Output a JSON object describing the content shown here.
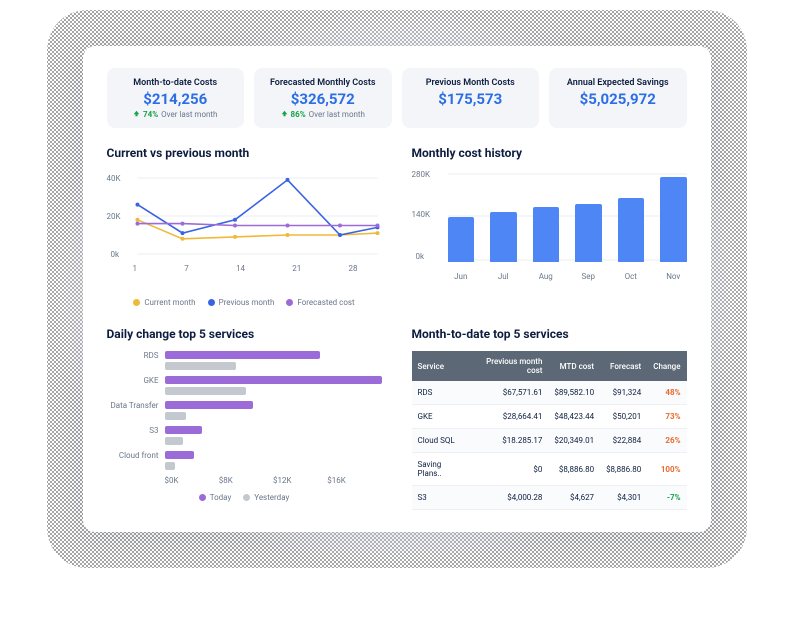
{
  "kpis": [
    {
      "title": "Month-to-date Costs",
      "value": "$214,256",
      "pct": "74%",
      "sub": "Over last month",
      "arrow": true
    },
    {
      "title": "Forecasted Monthly Costs",
      "value": "$326,572",
      "pct": "86%",
      "sub": "Over last month",
      "arrow": true
    },
    {
      "title": "Previous Month Costs",
      "value": "$175,573"
    },
    {
      "title": "Annual Expected Savings",
      "value": "$5,025,972"
    }
  ],
  "chart1": {
    "title": "Current vs previous month",
    "y_ticks": [
      "40K",
      "20K",
      "0k"
    ],
    "x_ticks": [
      "1",
      "7",
      "14",
      "21",
      "28"
    ],
    "legend": [
      {
        "label": "Current month",
        "color": "#f0b93a"
      },
      {
        "label": "Previous month",
        "color": "#3864e3"
      },
      {
        "label": "Forecasted cost",
        "color": "#9b6bd7"
      }
    ]
  },
  "chart2": {
    "title": "Monthly cost history",
    "y_ticks": [
      "280K",
      "140K",
      "0k"
    ]
  },
  "chart3": {
    "title": "Daily change top 5 services",
    "x_ticks": [
      "$0K",
      "$8K",
      "$12K",
      "$16K"
    ],
    "legend": [
      {
        "label": "Today",
        "color": "#9b6bd7"
      },
      {
        "label": "Yesterday",
        "color": "#c4c8cf"
      }
    ]
  },
  "table": {
    "title": "Month-to-date top 5 services",
    "headers": [
      "Service",
      "Previous month cost",
      "MTD cost",
      "Forecast",
      "Change"
    ],
    "rows": [
      {
        "service": "RDS",
        "prev": "$67,571.61",
        "mtd": "$89,582.10",
        "fc": "$91,324",
        "chg": "48%",
        "dir": "pos"
      },
      {
        "service": "GKE",
        "prev": "$28,664.41",
        "mtd": "$48,423.44",
        "fc": "$50,201",
        "chg": "73%",
        "dir": "pos"
      },
      {
        "service": "Cloud SQL",
        "prev": "$18.285.17",
        "mtd": "$20,349.01",
        "fc": "$22,884",
        "chg": "26%",
        "dir": "pos"
      },
      {
        "service": "Saving Plans..",
        "prev": "$0",
        "mtd": "$8,886.80",
        "fc": "$8,886.80",
        "chg": "100%",
        "dir": "pos"
      },
      {
        "service": "S3",
        "prev": "$4,000.28",
        "mtd": "$4,627",
        "fc": "$4,301",
        "chg": "-7%",
        "dir": "neg"
      }
    ]
  },
  "chart_data": [
    {
      "type": "line",
      "title": "Current vs previous month",
      "x": [
        1,
        7,
        14,
        21,
        28,
        33
      ],
      "ylim": [
        0,
        40
      ],
      "ylabel": "K",
      "series": [
        {
          "name": "Current month",
          "color": "#f0b93a",
          "values": [
            18,
            8,
            9,
            10,
            10,
            11
          ]
        },
        {
          "name": "Previous month",
          "color": "#3864e3",
          "values": [
            26,
            11,
            18,
            39,
            10,
            14
          ]
        },
        {
          "name": "Forecasted cost",
          "color": "#9b6bd7",
          "values": [
            16,
            16,
            15,
            15,
            15,
            15
          ]
        }
      ]
    },
    {
      "type": "bar",
      "title": "Monthly cost history",
      "categories": [
        "Jun",
        "Jul",
        "Aug",
        "Sep",
        "Oct",
        "Nov"
      ],
      "values": [
        140,
        155,
        170,
        180,
        200,
        265
      ],
      "ylim": [
        0,
        280
      ],
      "ylabel": "K"
    },
    {
      "type": "bar_horizontal",
      "title": "Daily change top 5 services",
      "categories": [
        "RDS",
        "GKE",
        "Data Transfer",
        "S3",
        "Cloud front"
      ],
      "xlim": [
        0,
        16
      ],
      "series": [
        {
          "name": "Today",
          "color": "#9b6bd7",
          "values": [
            11.5,
            16,
            6.5,
            2.8,
            2.2
          ]
        },
        {
          "name": "Yesterday",
          "color": "#c4c8cf",
          "values": [
            5.3,
            6.0,
            1.6,
            1.4,
            0.8
          ]
        }
      ]
    },
    {
      "type": "table",
      "title": "Month-to-date top 5 services",
      "headers": [
        "Service",
        "Previous month cost",
        "MTD cost",
        "Forecast",
        "Change"
      ],
      "rows": [
        [
          "RDS",
          "$67,571.61",
          "$89,582.10",
          "$91,324",
          "48%"
        ],
        [
          "GKE",
          "$28,664.41",
          "$48,423.44",
          "$50,201",
          "73%"
        ],
        [
          "Cloud SQL",
          "$18.285.17",
          "$20,349.01",
          "$22,884",
          "26%"
        ],
        [
          "Saving Plans..",
          "$0",
          "$8,886.80",
          "$8,886.80",
          "100%"
        ],
        [
          "S3",
          "$4,000.28",
          "$4,627",
          "$4,301",
          "-7%"
        ]
      ]
    }
  ]
}
